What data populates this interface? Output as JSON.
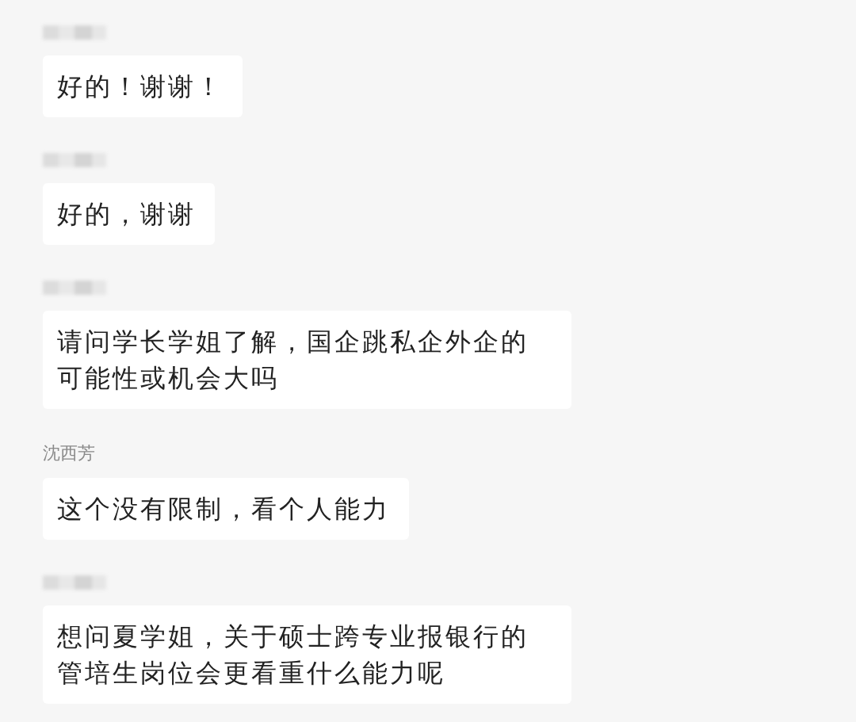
{
  "messages": [
    {
      "sender": {
        "kind": "hidden"
      },
      "text": "好的！谢谢！"
    },
    {
      "sender": {
        "kind": "hidden"
      },
      "text": "好的，谢谢"
    },
    {
      "sender": {
        "kind": "hidden"
      },
      "text": "请问学长学姐了解，国企跳私企外企的可能性或机会大吗"
    },
    {
      "sender": {
        "kind": "name",
        "name": "沈西芳"
      },
      "text": "这个没有限制，看个人能力"
    },
    {
      "sender": {
        "kind": "hidden"
      },
      "text": "想问夏学姐，关于硕士跨专业报银行的管培生岗位会更看重什么能力呢"
    }
  ]
}
